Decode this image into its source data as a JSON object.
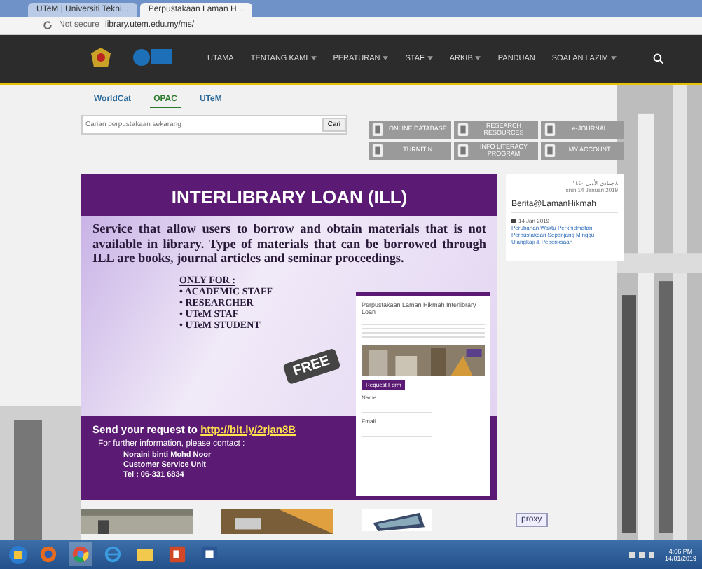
{
  "browser": {
    "tabs": [
      {
        "label": "UTeM | Universiti Tekni...",
        "selected": false
      },
      {
        "label": "Perpustakaan Laman H...",
        "selected": true
      }
    ],
    "security": "Not secure",
    "url": "library.utem.edu.my/ms/"
  },
  "nav": {
    "items": [
      {
        "label": "UTAMA",
        "dropdown": false
      },
      {
        "label": "TENTANG KAMI",
        "dropdown": true
      },
      {
        "label": "PERATURAN",
        "dropdown": true
      },
      {
        "label": "STAF",
        "dropdown": true
      },
      {
        "label": "ARKIB",
        "dropdown": true
      },
      {
        "label": "PANDUAN",
        "dropdown": false
      },
      {
        "label": "SOALAN LAZIM",
        "dropdown": true
      }
    ]
  },
  "search_tabs": [
    {
      "label": "WorldCat",
      "selected": false
    },
    {
      "label": "OPAC",
      "selected": true
    },
    {
      "label": "UTeM",
      "selected": false
    }
  ],
  "search": {
    "placeholder": "Carian perpustakaan sekarang",
    "button": "Cari"
  },
  "quick_links": [
    {
      "label": "ONLINE DATABASE"
    },
    {
      "label": "RESEARCH RESOURCES"
    },
    {
      "label": "e-JOURNAL"
    },
    {
      "label": "TURNITIN"
    },
    {
      "label": "INFO LITERACY PROGRAM"
    },
    {
      "label": "MY ACCOUNT"
    }
  ],
  "banner": {
    "title": "INTERLIBRARY LOAN (ILL)",
    "description": "Service that allow users to borrow and obtain materials that is not available in library. Type of materials that can be borrowed through ILL are books, journal articles and seminar proceedings.",
    "eligibility_heading": "ONLY FOR :",
    "eligibility": [
      "• ACADEMIC STAFF",
      "• RESEARCHER",
      "• UTeM STAF",
      "• UTeM STUDENT"
    ],
    "tag": "FREE",
    "request_text": "Send your request to",
    "request_link": "http://bit.ly/2rjan8B",
    "contact_heading": "For further information, please contact :",
    "contact": [
      "Noraini binti Mohd Noor",
      "Customer Service Unit",
      "Tel : 06-331 6834"
    ],
    "form": {
      "title": "Perpustakaan Laman Hikmah Interlibrary Loan",
      "button": "Request Form",
      "fields": [
        {
          "label": "Name"
        },
        {
          "label": "Email"
        }
      ]
    }
  },
  "sidebar": {
    "hijri_date": "٨ جمادى الأولى ١٤٤٠",
    "date": "Isnin 14 Januari 2019",
    "heading": "Berita@LamanHikmah",
    "news": [
      {
        "date": "14 Jan 2019",
        "title": "Perubahan Waktu Perkhidmatan Perpustakaan Sepanjang Minggu Ulangkaji & Peperiksaan"
      }
    ]
  },
  "footer_logo": "proxy",
  "taskbar": {
    "time": "4:06 PM",
    "date": "14/01/2019"
  }
}
